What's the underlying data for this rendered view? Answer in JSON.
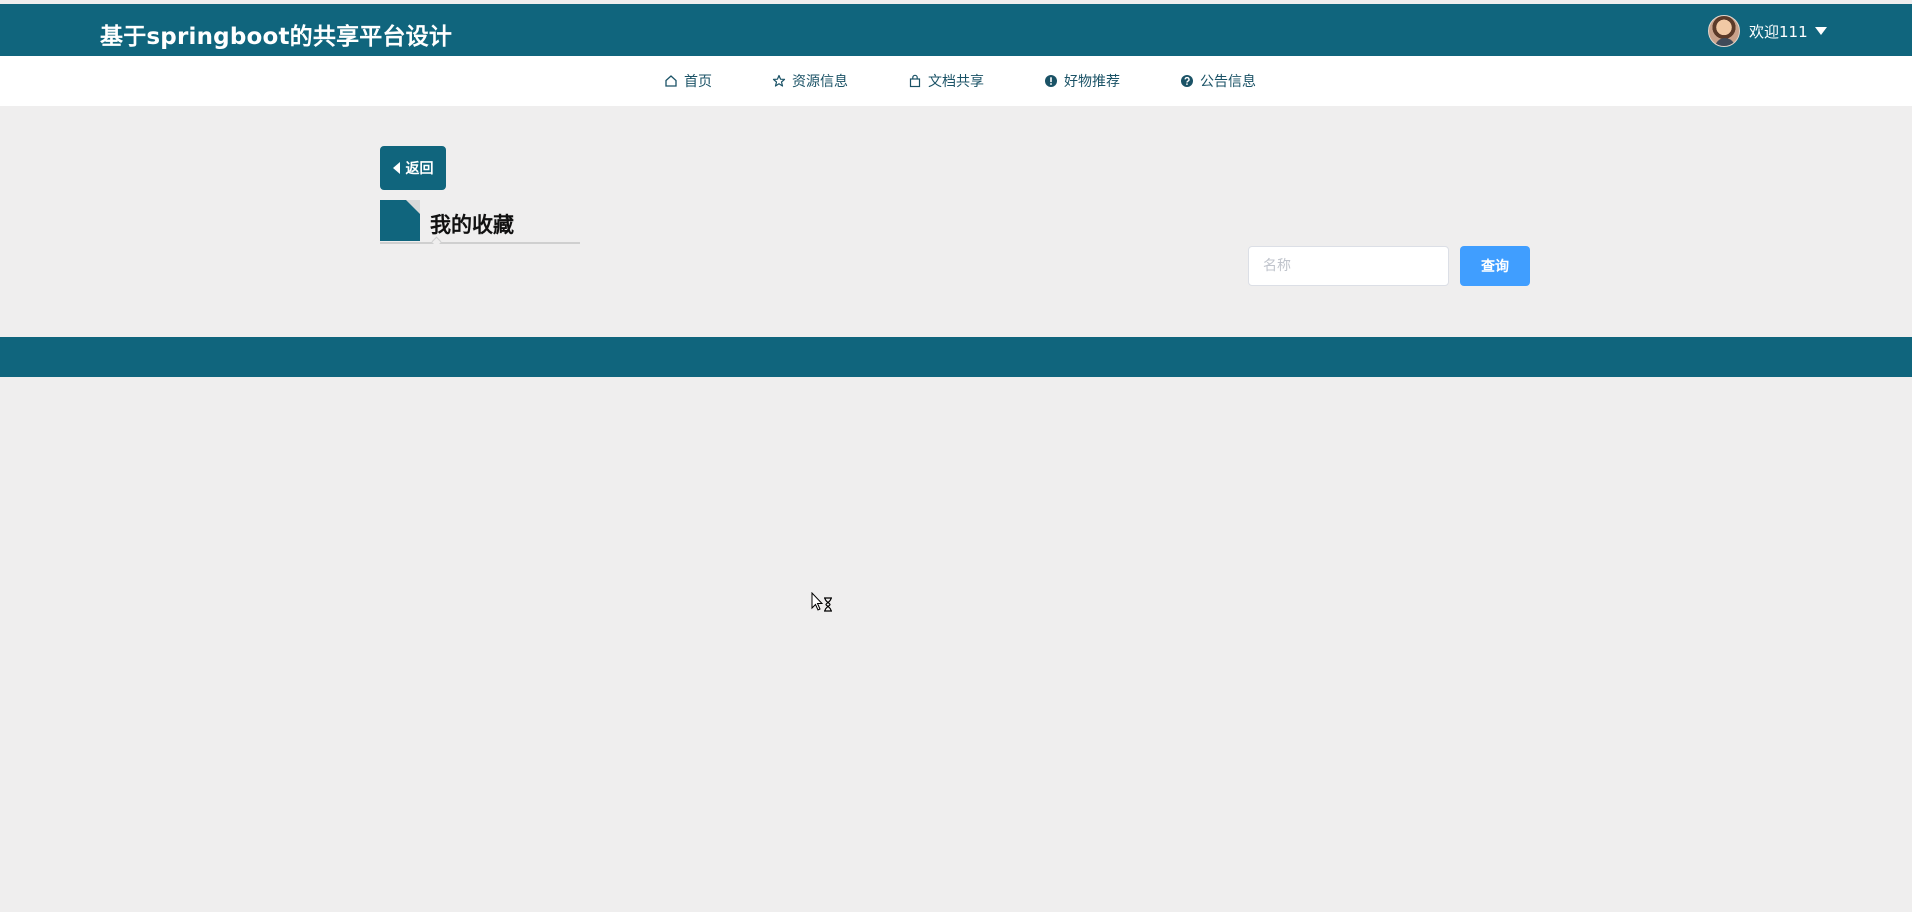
{
  "header": {
    "site_title": "基于springboot的共享平台设计",
    "welcome_text": "欢迎111"
  },
  "nav": {
    "items": [
      {
        "label": "首页",
        "icon": "home-icon"
      },
      {
        "label": "资源信息",
        "icon": "star-icon"
      },
      {
        "label": "文档共享",
        "icon": "bag-icon"
      },
      {
        "label": "好物推荐",
        "icon": "exclamation-circle-icon"
      },
      {
        "label": "公告信息",
        "icon": "question-circle-icon"
      }
    ]
  },
  "page": {
    "back_label": "返回",
    "section_title": "我的收藏"
  },
  "search": {
    "placeholder": "名称",
    "value": "",
    "button_label": "查询"
  },
  "colors": {
    "primary": "#10657d",
    "search_button": "#409eff",
    "background": "#efeeee"
  }
}
